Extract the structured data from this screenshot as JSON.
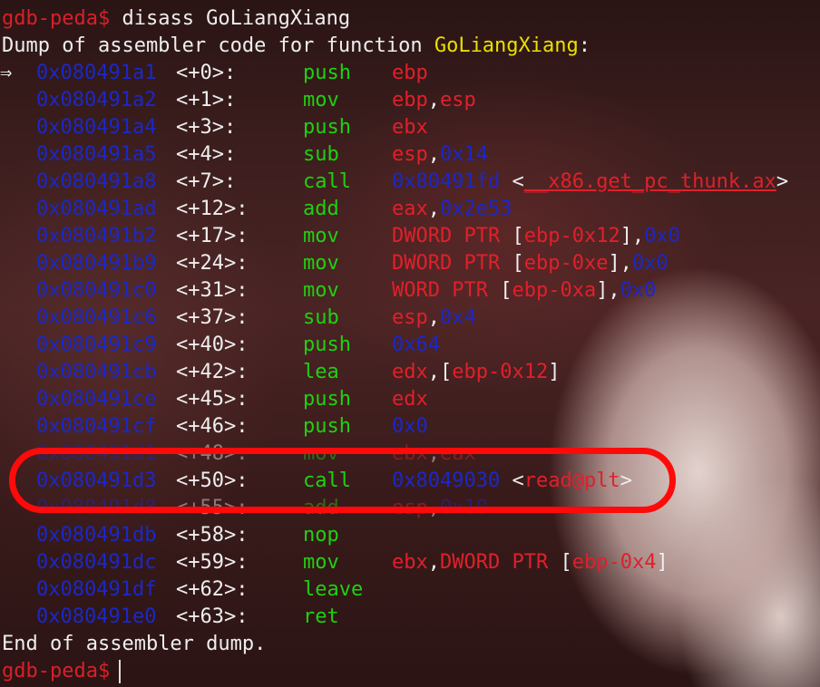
{
  "terminal": {
    "prompt": "gdb-peda$",
    "command": " disass GoLiangXiang",
    "dump_header_prefix": "Dump of assembler code for function ",
    "function_name": "GoLiangXiang",
    "dump_header_suffix": ":",
    "current_marker": "⇒",
    "footer": "End of assembler dump.",
    "final_prompt": "gdb-peda$"
  },
  "instructions": [
    {
      "addr": "0x080491a1",
      "off": "<+0>:",
      "mnem": "push",
      "ops": [
        {
          "t": "ebp",
          "c": "reg"
        }
      ]
    },
    {
      "addr": "0x080491a2",
      "off": "<+1>:",
      "mnem": "mov",
      "ops": [
        {
          "t": "ebp",
          "c": "reg"
        },
        {
          "t": ",",
          "c": "white"
        },
        {
          "t": "esp",
          "c": "reg"
        }
      ]
    },
    {
      "addr": "0x080491a4",
      "off": "<+3>:",
      "mnem": "push",
      "ops": [
        {
          "t": "ebx",
          "c": "reg"
        }
      ]
    },
    {
      "addr": "0x080491a5",
      "off": "<+4>:",
      "mnem": "sub",
      "ops": [
        {
          "t": "esp",
          "c": "reg"
        },
        {
          "t": ",",
          "c": "white"
        },
        {
          "t": "0x14",
          "c": "num"
        }
      ]
    },
    {
      "addr": "0x080491a8",
      "off": "<+7>:",
      "mnem": "call",
      "ops": [
        {
          "t": "0x80491fd",
          "c": "num"
        },
        {
          "t": " <",
          "c": "white"
        },
        {
          "t": "__x86.get_pc_thunk.ax",
          "c": "sym ul"
        },
        {
          "t": ">",
          "c": "white"
        }
      ]
    },
    {
      "addr": "0x080491ad",
      "off": "<+12>:",
      "mnem": "add",
      "ops": [
        {
          "t": "eax",
          "c": "reg"
        },
        {
          "t": ",",
          "c": "white"
        },
        {
          "t": "0x2e53",
          "c": "num"
        }
      ]
    },
    {
      "addr": "0x080491b2",
      "off": "<+17>:",
      "mnem": "mov",
      "ops": [
        {
          "t": "DWORD PTR",
          "c": "reg"
        },
        {
          "t": " [",
          "c": "white"
        },
        {
          "t": "ebp-0x12",
          "c": "reg"
        },
        {
          "t": "],",
          "c": "white"
        },
        {
          "t": "0x0",
          "c": "num"
        }
      ]
    },
    {
      "addr": "0x080491b9",
      "off": "<+24>:",
      "mnem": "mov",
      "ops": [
        {
          "t": "DWORD PTR",
          "c": "reg"
        },
        {
          "t": " [",
          "c": "white"
        },
        {
          "t": "ebp-0xe",
          "c": "reg"
        },
        {
          "t": "],",
          "c": "white"
        },
        {
          "t": "0x0",
          "c": "num"
        }
      ]
    },
    {
      "addr": "0x080491c0",
      "off": "<+31>:",
      "mnem": "mov",
      "ops": [
        {
          "t": "WORD PTR",
          "c": "reg"
        },
        {
          "t": " [",
          "c": "white"
        },
        {
          "t": "ebp-0xa",
          "c": "reg"
        },
        {
          "t": "],",
          "c": "white"
        },
        {
          "t": "0x0",
          "c": "num"
        }
      ]
    },
    {
      "addr": "0x080491c6",
      "off": "<+37>:",
      "mnem": "sub",
      "ops": [
        {
          "t": "esp",
          "c": "reg"
        },
        {
          "t": ",",
          "c": "white"
        },
        {
          "t": "0x4",
          "c": "num"
        }
      ]
    },
    {
      "addr": "0x080491c9",
      "off": "<+40>:",
      "mnem": "push",
      "ops": [
        {
          "t": "0x64",
          "c": "num"
        }
      ]
    },
    {
      "addr": "0x080491cb",
      "off": "<+42>:",
      "mnem": "lea",
      "ops": [
        {
          "t": "edx",
          "c": "reg"
        },
        {
          "t": ",[",
          "c": "white"
        },
        {
          "t": "ebp-0x12",
          "c": "reg"
        },
        {
          "t": "]",
          "c": "white"
        }
      ]
    },
    {
      "addr": "0x080491ce",
      "off": "<+45>:",
      "mnem": "push",
      "ops": [
        {
          "t": "edx",
          "c": "reg"
        }
      ]
    },
    {
      "addr": "0x080491cf",
      "off": "<+46>:",
      "mnem": "push",
      "ops": [
        {
          "t": "0x0",
          "c": "num"
        }
      ]
    },
    {
      "addr": "0x080491d1",
      "off": "<+48>:",
      "mnem": "mov",
      "ops": [
        {
          "t": "ebx",
          "c": "reg"
        },
        {
          "t": ",",
          "c": "white"
        },
        {
          "t": "eax",
          "c": "reg"
        }
      ]
    },
    {
      "addr": "0x080491d3",
      "off": "<+50>:",
      "mnem": "call",
      "ops": [
        {
          "t": "0x8049030",
          "c": "num"
        },
        {
          "t": " <",
          "c": "white"
        },
        {
          "t": "read@plt",
          "c": "sym"
        },
        {
          "t": ">",
          "c": "white"
        }
      ]
    },
    {
      "addr": "0x080491d8",
      "off": "<+55>:",
      "mnem": "add",
      "ops": [
        {
          "t": "esp",
          "c": "reg"
        },
        {
          "t": ",",
          "c": "white"
        },
        {
          "t": "0x10",
          "c": "num"
        }
      ]
    },
    {
      "addr": "0x080491db",
      "off": "<+58>:",
      "mnem": "nop",
      "ops": []
    },
    {
      "addr": "0x080491dc",
      "off": "<+59>:",
      "mnem": "mov",
      "ops": [
        {
          "t": "ebx",
          "c": "reg"
        },
        {
          "t": ",",
          "c": "white"
        },
        {
          "t": "DWORD PTR",
          "c": "reg"
        },
        {
          "t": " [",
          "c": "white"
        },
        {
          "t": "ebp-0x4",
          "c": "reg"
        },
        {
          "t": "]",
          "c": "white"
        }
      ]
    },
    {
      "addr": "0x080491df",
      "off": "<+62>:",
      "mnem": "leave",
      "ops": []
    },
    {
      "addr": "0x080491e0",
      "off": "<+63>:",
      "mnem": "ret",
      "ops": []
    }
  ]
}
